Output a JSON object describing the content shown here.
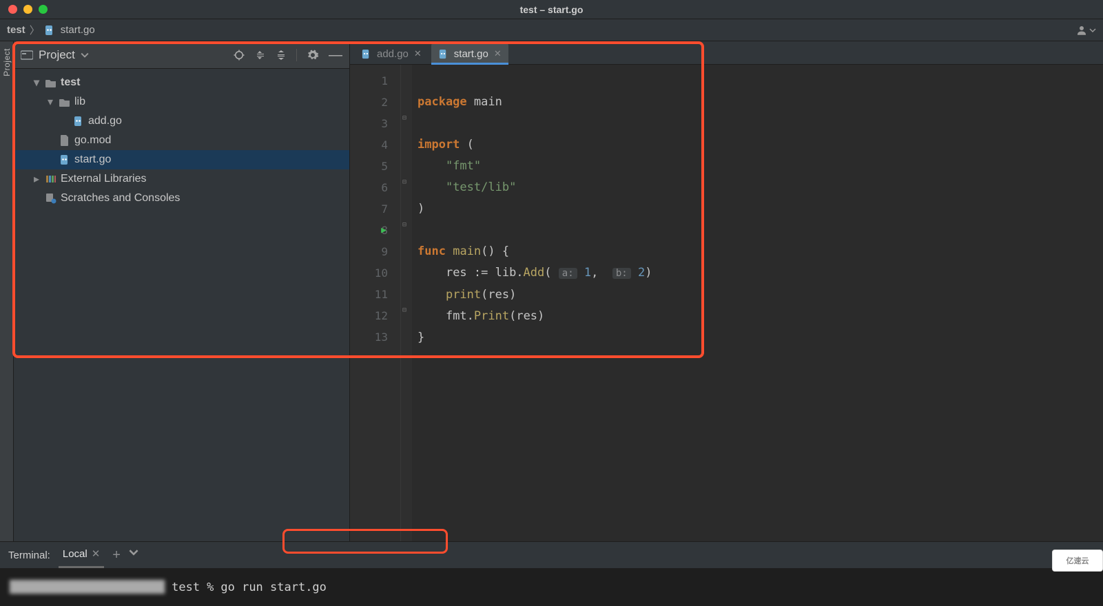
{
  "window": {
    "title": "test – start.go"
  },
  "breadcrumb": {
    "root": "test",
    "file": "start.go"
  },
  "sidebar_stripe": {
    "label": "Project"
  },
  "project_header": {
    "title": "Project"
  },
  "tree": {
    "root": {
      "name": "test"
    },
    "lib_folder": {
      "name": "lib"
    },
    "add_file": {
      "name": "add.go"
    },
    "gomod_file": {
      "name": "go.mod"
    },
    "start_file": {
      "name": "start.go"
    },
    "ext_libs": {
      "name": "External Libraries"
    },
    "scratches": {
      "name": "Scratches and Consoles"
    }
  },
  "tabs": [
    {
      "label": "add.go",
      "active": false
    },
    {
      "label": "start.go",
      "active": true
    }
  ],
  "code": {
    "lines": [
      "1",
      "2",
      "3",
      "4",
      "5",
      "6",
      "7",
      "8",
      "9",
      "10",
      "11",
      "12",
      "13"
    ],
    "run_line": 8,
    "l1_kw": "package",
    "l1_id": "main",
    "l3_kw": "import",
    "l3_paren": "(",
    "l4_str": "\"fmt\"",
    "l5_str": "\"test/lib\"",
    "l6_paren": ")",
    "l8_kw": "func",
    "l8_name": "main",
    "l8_rest": "() {",
    "l9_a": "res := lib.",
    "l9_fn": "Add",
    "l9_open": "(",
    "l9_h1": "a:",
    "l9_v1": "1",
    "l9_comma": ",",
    "l9_h2": "b:",
    "l9_v2": "2",
    "l9_close": ")",
    "l10_fn": "print",
    "l10_rest": "(res)",
    "l11_a": "fmt.",
    "l11_fn": "Print",
    "l11_rest": "(res)",
    "l12": "}"
  },
  "terminal": {
    "label": "Terminal:",
    "tab": "Local",
    "prompt_dir": "test",
    "prompt_sym": "%",
    "command": "go run start.go"
  },
  "watermark": "亿速云"
}
